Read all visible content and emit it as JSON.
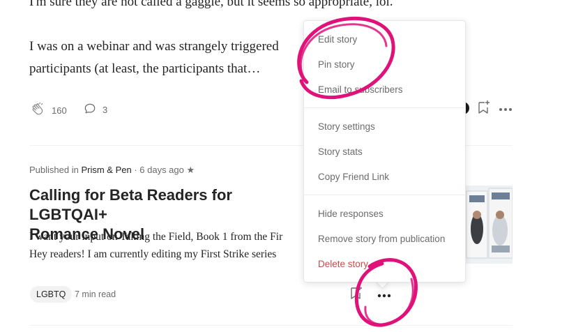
{
  "story1": {
    "line_cut": "I'm sure they are not called a gaggle, but it seems so appropriate, lol.",
    "line_a": "I was on a webinar and was strangely triggered",
    "line_b": "participants (at least, the participants that…",
    "claps": "160",
    "responses": "3"
  },
  "story2": {
    "published_prefix": "Published in",
    "publication": "Prism & Pen",
    "age": "· 6 days ago",
    "star": "★",
    "title_line1": "Calling for Beta Readers for LGBTQAI+",
    "title_line2": "Romance Novel",
    "excerpt_line1": "I want your input on Taking the Field, Book 1 from the Fir",
    "excerpt_line2": "Hey readers! I am currently editing my First Strike series",
    "tag": "LGBTQ",
    "read_time": "7 min read"
  },
  "menu": {
    "group1": [
      "Edit story",
      "Pin story",
      "Email to subscribers"
    ],
    "group2": [
      "Story settings",
      "Story stats",
      "Copy Friend Link"
    ],
    "group3": [
      "Hide responses",
      "Remove story from publication"
    ],
    "delete": "Delete story"
  },
  "icons": {
    "clap": "clap-icon",
    "response": "speech-bubble-icon",
    "bookmark": "bookmark-add-icon",
    "more": "more-horizontal-icon"
  },
  "colors": {
    "text": "#242424",
    "muted": "#6b6b6b",
    "danger": "#c94a4a",
    "annotation": "#e0127a"
  }
}
